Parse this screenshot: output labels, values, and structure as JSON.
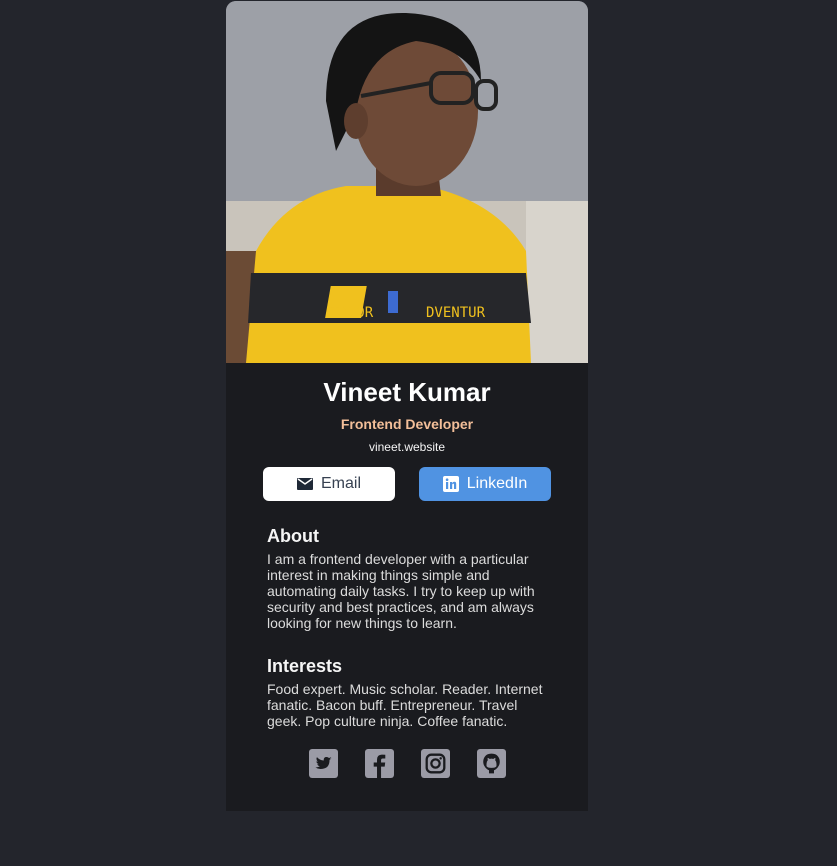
{
  "profile": {
    "name": "Vineet Kumar",
    "role": "Frontend Developer",
    "website": "vineet.website",
    "photo_icon": "profile-photo"
  },
  "buttons": {
    "email_label": "Email",
    "linkedin_label": "LinkedIn"
  },
  "about": {
    "heading": "About",
    "text": "I am a frontend developer with a particular interest in making things simple and automating daily tasks. I try to keep up with security and best practices, and am always looking for new things to learn."
  },
  "interests": {
    "heading": "Interests",
    "text": "Food expert. Music scholar. Reader. Internet fanatic. Bacon buff. Entrepreneur. Travel geek. Pop culture ninja. Coffee fanatic."
  },
  "social": [
    "twitter-icon",
    "facebook-icon",
    "instagram-icon",
    "github-icon"
  ],
  "colors": {
    "page_bg": "#23252c",
    "card_bg": "#1a1b1f",
    "role_accent": "#f3bf99",
    "linkedin_blue": "#5093e2",
    "social_gray": "#9b9ba6"
  }
}
